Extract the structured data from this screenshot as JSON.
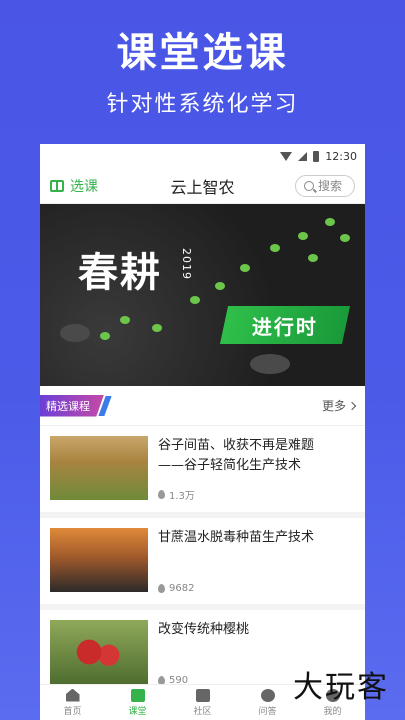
{
  "promo": {
    "title": "课堂选课",
    "subtitle": "针对性系统化学习"
  },
  "status_bar": {
    "time": "12:30"
  },
  "header": {
    "course_button_label": "选课",
    "app_title": "云上智农",
    "search_placeholder": "搜索"
  },
  "banner": {
    "title": "春耕",
    "year": "2019",
    "tag": "进行时"
  },
  "section": {
    "badge": "精选课程",
    "more_label": "更多"
  },
  "courses": [
    {
      "title_line1": "谷子间苗、收获不再是难题",
      "title_line2": "——谷子轻简化生产技术",
      "views": "1.3万"
    },
    {
      "title_line1": "甘蔗温水脱毒种苗生产技术",
      "title_line2": "",
      "views": "9682"
    },
    {
      "title_line1": "改变传统种樱桃",
      "title_line2": "",
      "views": "590"
    }
  ],
  "tabs": [
    {
      "label": "首页",
      "icon": "home-icon"
    },
    {
      "label": "课堂",
      "icon": "classroom-icon"
    },
    {
      "label": "社区",
      "icon": "community-icon"
    },
    {
      "label": "问答",
      "icon": "qa-icon"
    },
    {
      "label": "我的",
      "icon": "me-icon"
    }
  ],
  "watermark": "大玩客",
  "colors": {
    "background": "#4a55e6",
    "accent_green": "#36b24a",
    "badge_purple": "#6b3fd6",
    "badge_pink": "#c54aa8"
  }
}
